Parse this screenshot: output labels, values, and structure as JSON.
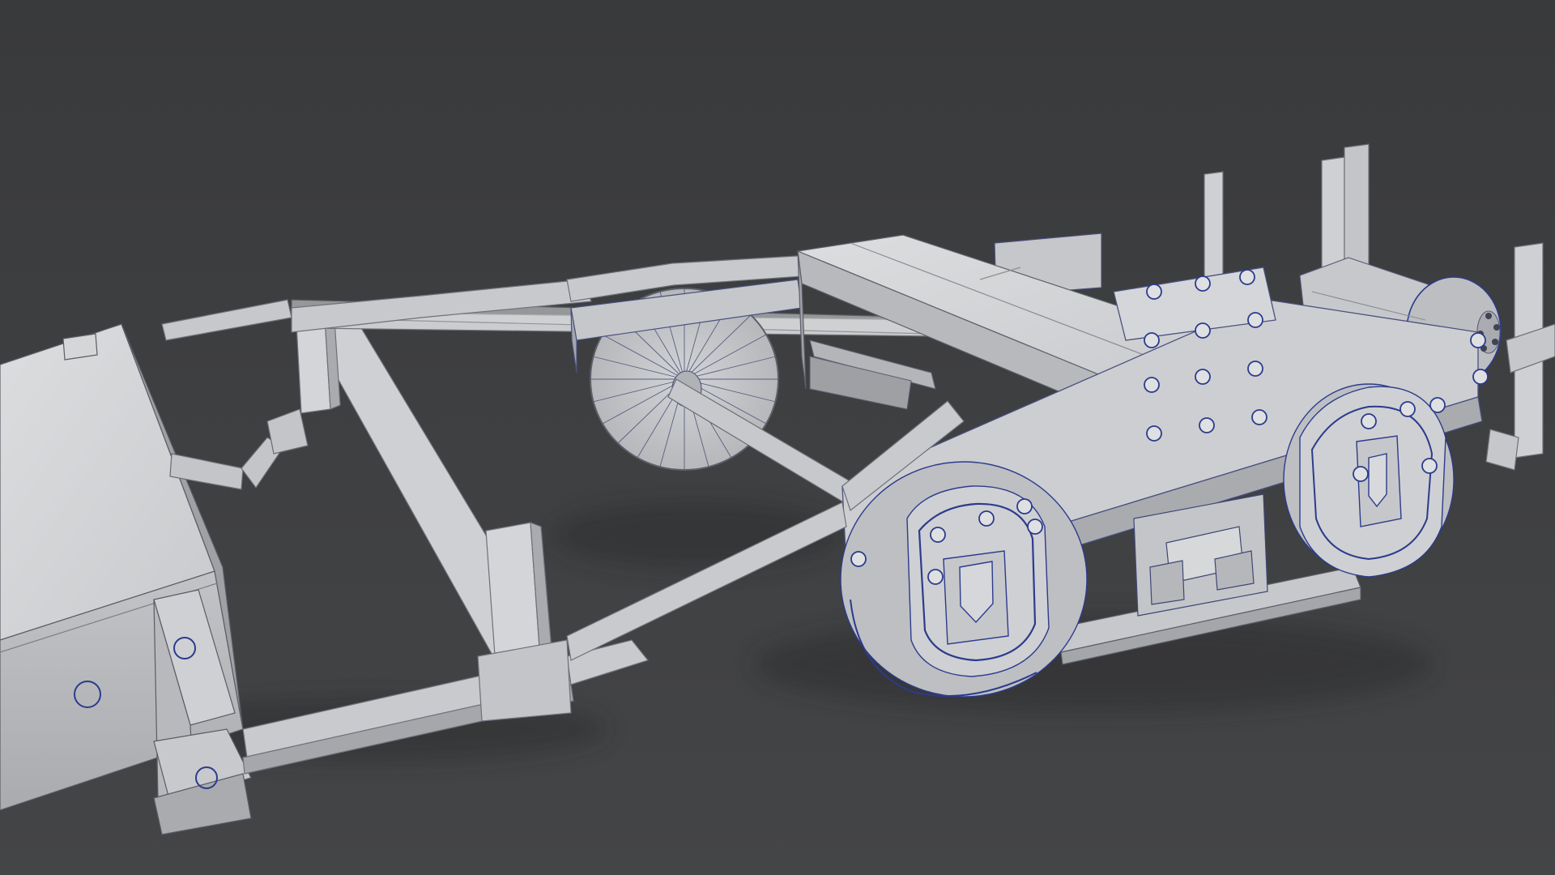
{
  "scene": {
    "subject": "3d-render-wireframe-chassis",
    "colors": {
      "background_top": "#3a3b3d",
      "background_bottom": "#434446",
      "surface_light": "#d7d8da",
      "surface_mid": "#b9bbbe",
      "surface_dark": "#8e9094",
      "edge_wire": "#50527a",
      "seam_blue": "#2c3b8c"
    }
  }
}
